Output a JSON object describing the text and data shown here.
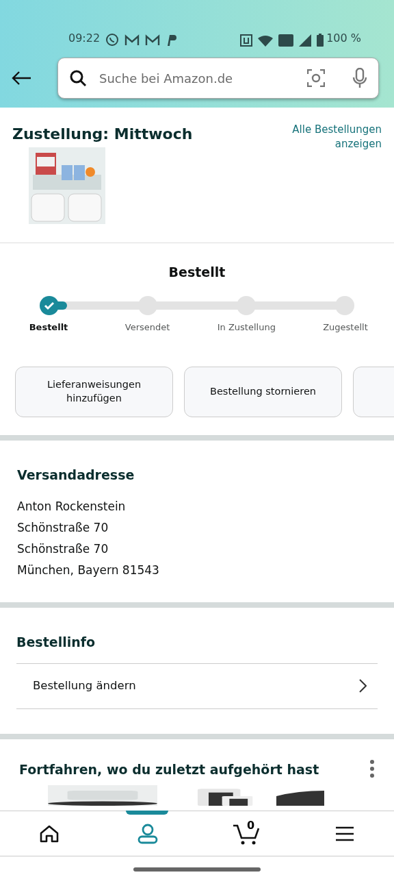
{
  "status_bar": {
    "time": "09:22",
    "battery": "100 %"
  },
  "search": {
    "placeholder": "Suche bei Amazon.de"
  },
  "delivery": {
    "title": "Zustellung: Mittwoch",
    "link": "Alle Bestellungen anzeigen"
  },
  "tracker": {
    "title": "Bestellt",
    "level": 0.06,
    "steps": [
      {
        "label": "Bestellt",
        "done": true,
        "selected": true
      },
      {
        "label": "Versendet",
        "done": false,
        "selected": false
      },
      {
        "label": "In Zustellung",
        "done": false,
        "selected": false
      },
      {
        "label": "Zugestellt",
        "done": false,
        "selected": false
      }
    ]
  },
  "actions": [
    {
      "kind": "button",
      "label": "Lieferanweisungen hinzufügen"
    },
    {
      "kind": "button",
      "label": "Bestellung stornieren"
    },
    {
      "kind": "button"
    }
  ],
  "address": {
    "title": "Versandadresse",
    "lines": [
      "Anton Rockenstein",
      "Schönstraße 70",
      "Schönstraße 70",
      "München, Bayern 81543"
    ]
  },
  "order_info": {
    "title": "Bestellinfo",
    "rows": [
      {
        "label": "Bestellung ändern"
      }
    ]
  },
  "recent": {
    "title": "Fortfahren, wo du zuletzt aufgehört hast"
  },
  "bottom_nav": [
    {
      "kind": "home",
      "selected": false
    },
    {
      "kind": "account",
      "selected": true
    },
    {
      "kind": "cart",
      "count": "0",
      "selected": false
    },
    {
      "kind": "menu",
      "selected": false
    }
  ]
}
